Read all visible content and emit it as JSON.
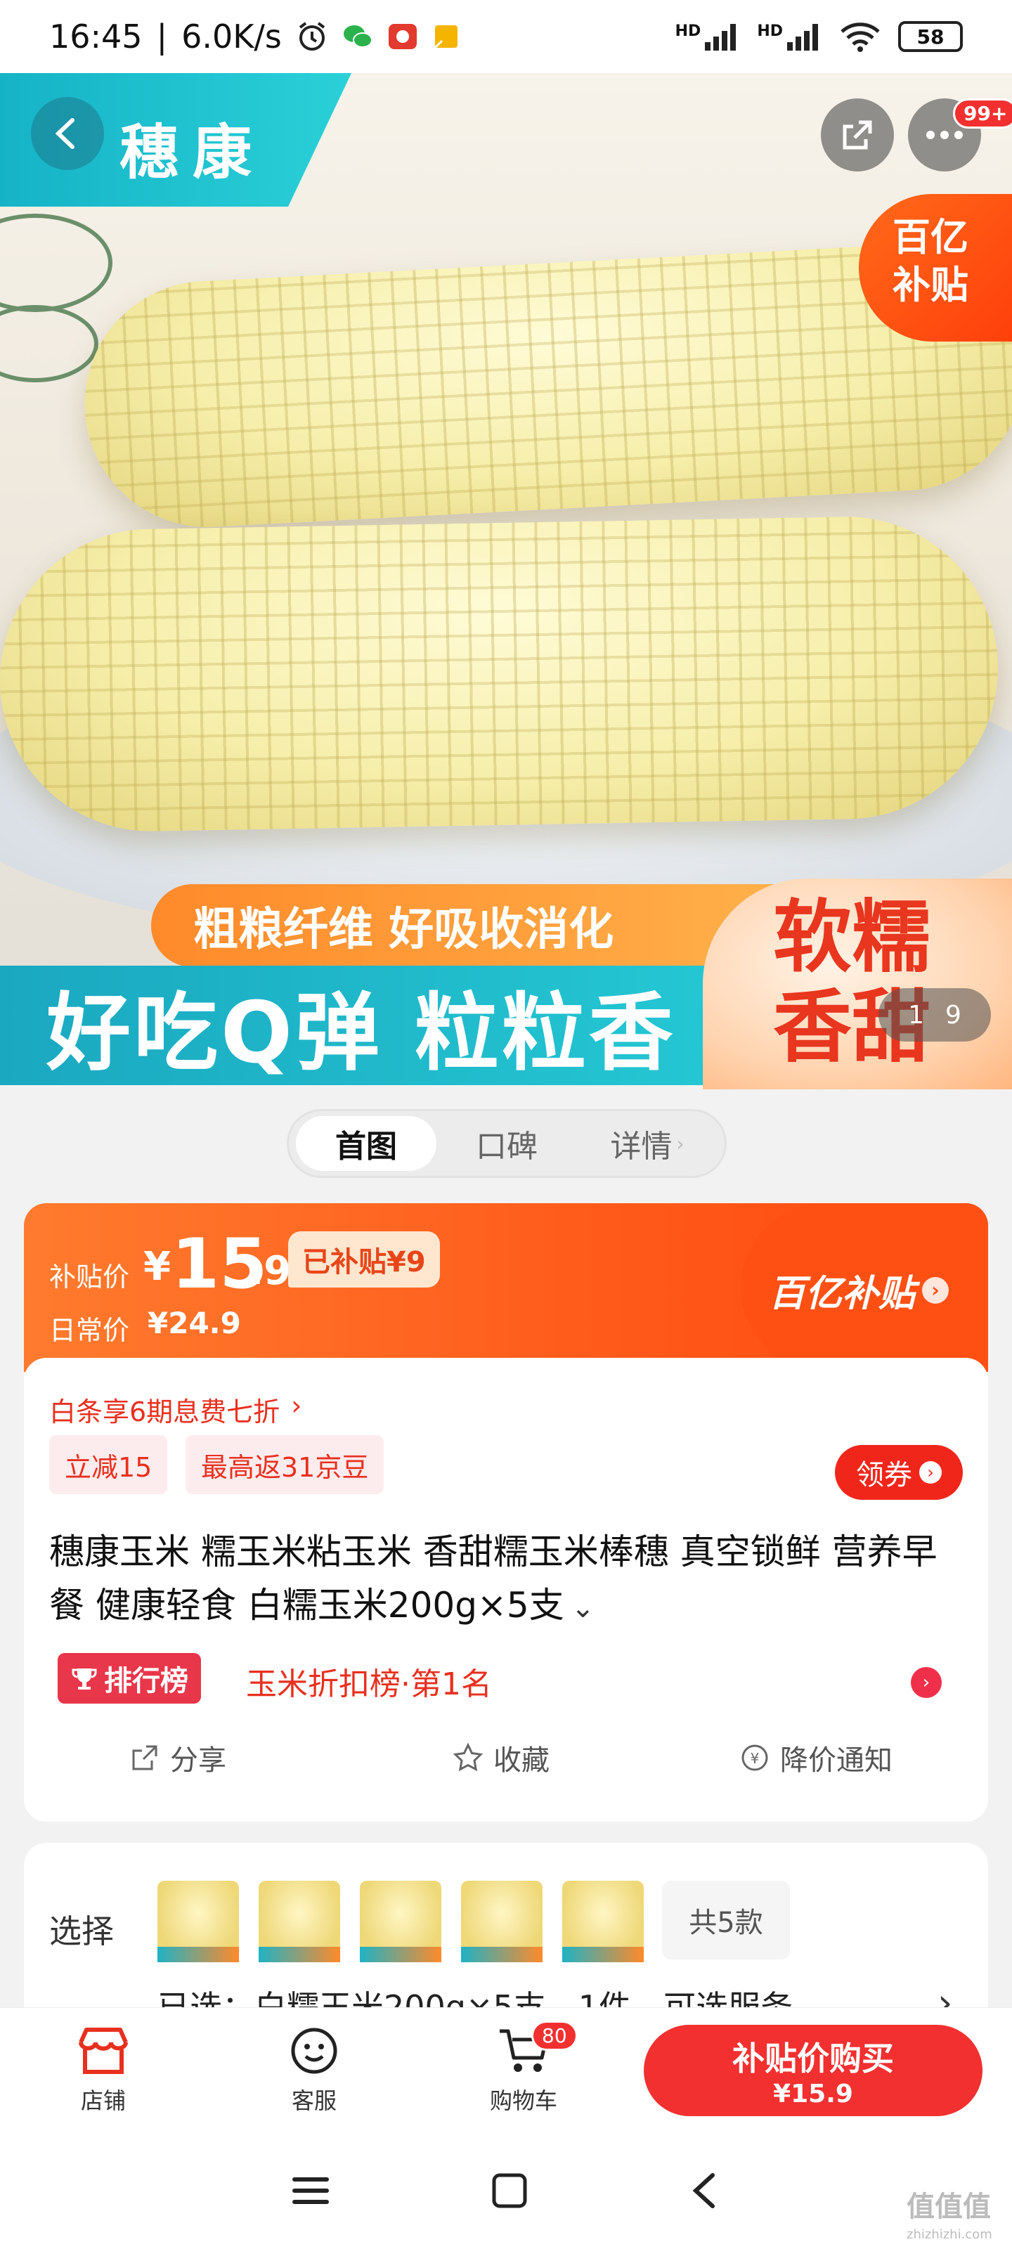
{
  "status_bar": {
    "time": "16:45",
    "net_speed": "6.0K/s",
    "network_label_1": "HD",
    "network_label_2": "HD",
    "battery": "58"
  },
  "hero": {
    "brand": "穗康",
    "badge_count": "99+",
    "subsidy_badge_line1": "百亿",
    "subsidy_badge_line2": "补贴",
    "slogan_1": "粗粮纤维 好吸收消化",
    "slogan_2": "好吃Q弹 粒粒香",
    "soft_line1": "软糯",
    "soft_line2": "香甜",
    "pager_current": "1",
    "pager_total": "9"
  },
  "tabs": [
    {
      "label": "首图"
    },
    {
      "label": "口碑"
    },
    {
      "label": "详情"
    }
  ],
  "price": {
    "subsidy_label": "补贴价",
    "currency": "¥",
    "price_int": "15",
    "price_dec": ".9",
    "subsidy_tag": "已补贴¥9",
    "regular_label": "日常价",
    "regular_price": "¥24.9",
    "program": "百亿补贴"
  },
  "promo": {
    "baitiao": "白条享6期息费七折",
    "chip_1": "立减15",
    "chip_2": "最高返31京豆",
    "coupon": "领券"
  },
  "product": {
    "title": "穗康玉米 糯玉米粘玉米 香甜糯玉米棒穗 真空锁鲜 营养早餐 健康轻食 白糯玉米200g×5支",
    "rank_badge": "排行榜",
    "rank_text": "玉米折扣榜·第1名"
  },
  "actions": [
    {
      "label": "分享"
    },
    {
      "label": "收藏"
    },
    {
      "label": "降价通知"
    }
  ],
  "select": {
    "label": "选择",
    "count": "共5款",
    "selected_text": "已选：白糯玉米200g×5支，1件，可选服务"
  },
  "bottom_bar": {
    "store": "店铺",
    "service": "客服",
    "cart": "购物车",
    "cart_count": "80",
    "buy_line1": "补贴价购买",
    "buy_line2": "¥15.9"
  },
  "watermark": {
    "text": "值值值",
    "url": "zhizhizhi.com"
  },
  "colors": {
    "accent_red": "#f23030",
    "orange": "#ff5a1a",
    "teal": "#1aa8c0"
  }
}
